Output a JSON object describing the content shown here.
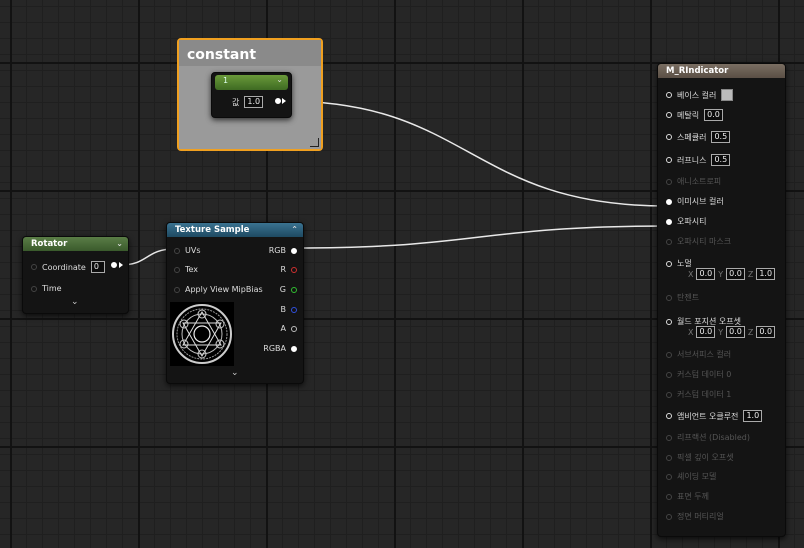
{
  "comment_box": {
    "title": "constant"
  },
  "constant_node": {
    "input_label": "값",
    "value": "1.0",
    "header_label": "1"
  },
  "rotator_node": {
    "title": "Rotator",
    "coordinate_label": "Coordinate",
    "coordinate_value": "0",
    "time_label": "Time",
    "expand_glyph": "⌄"
  },
  "texture_node": {
    "title": "Texture Sample",
    "inputs": [
      "UVs",
      "Tex",
      "Apply View MipBias"
    ],
    "outputs": [
      "RGB",
      "R",
      "G",
      "B",
      "A",
      "RGBA"
    ],
    "output_colors": [
      "#ffffff",
      "#d03030",
      "#30c030",
      "#3050e0",
      "#bbbbbb",
      "#ffffff"
    ],
    "expand_glyph": "⌄"
  },
  "material_node": {
    "title": "M_RIndicator",
    "pins": [
      {
        "label": "베이스 컬러",
        "active": true,
        "connected": false,
        "value": "",
        "swatch": true
      },
      {
        "label": "메탈릭",
        "active": true,
        "connected": false,
        "value": "0.0"
      },
      {
        "label": "스페큘러",
        "active": true,
        "connected": false,
        "value": "0.5"
      },
      {
        "label": "러프니스",
        "active": true,
        "connected": false,
        "value": "0.5"
      },
      {
        "label": "애니소트로피",
        "active": false,
        "connected": false,
        "value": ""
      },
      {
        "label": "이미시브 컬러",
        "active": true,
        "connected": true,
        "value": ""
      },
      {
        "label": "오파시티",
        "active": true,
        "connected": true,
        "value": ""
      },
      {
        "label": "오파시티 마스크",
        "active": false,
        "connected": false,
        "value": ""
      },
      {
        "label": "노멀",
        "active": true,
        "connected": false,
        "value": "",
        "vec": [
          "0.0",
          "0.0",
          "1.0"
        ]
      },
      {
        "label": "탄젠트",
        "active": false,
        "connected": false,
        "value": ""
      },
      {
        "label": "월드 포지션 오프셋",
        "active": true,
        "connected": false,
        "value": "",
        "vec": [
          "0.0",
          "0.0",
          "0.0"
        ]
      },
      {
        "label": "서브서피스 컬러",
        "active": false,
        "connected": false,
        "value": ""
      },
      {
        "label": "커스텀 데이터 0",
        "active": false,
        "connected": false,
        "value": ""
      },
      {
        "label": "커스텀 데이터 1",
        "active": false,
        "connected": false,
        "value": ""
      },
      {
        "label": "앰비언트 오클루전",
        "active": true,
        "connected": false,
        "value": "1.0"
      },
      {
        "label": "리프랙션 (Disabled)",
        "active": false,
        "connected": false,
        "value": ""
      },
      {
        "label": "픽셀 깊이 오프셋",
        "active": false,
        "connected": false,
        "value": ""
      },
      {
        "label": "셰이딩 모델",
        "active": false,
        "connected": false,
        "value": ""
      },
      {
        "label": "표면 두께",
        "active": false,
        "connected": false,
        "value": ""
      },
      {
        "label": "정면 머티리얼",
        "active": false,
        "connected": false,
        "value": ""
      }
    ],
    "axis_labels": [
      "X",
      "Y",
      "Z"
    ]
  },
  "colors": {
    "rotator_header": "#4c6b3a",
    "texture_header": "#2c5e7a",
    "material_header": "#6e6257",
    "comment_border": "#f0a020",
    "constant_header": "#5a8a32"
  }
}
